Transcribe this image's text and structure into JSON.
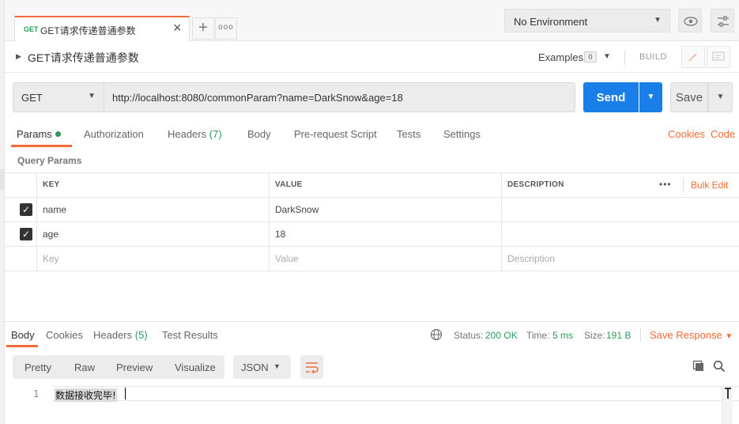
{
  "tab": {
    "method": "GET",
    "name": "GET请求传递普通参数",
    "close": "✕",
    "add": "+",
    "more": "ooo"
  },
  "environment": {
    "selected": "No Environment"
  },
  "request": {
    "title": "GET请求传递普通参数",
    "examples_label": "Examples",
    "examples_count": "0",
    "build_label": "BUILD",
    "method": "GET",
    "url": "http://localhost:8080/commonParam?name=DarkSnow&age=18",
    "send_label": "Send",
    "save_label": "Save"
  },
  "request_tabs": {
    "params": "Params",
    "authorization": "Authorization",
    "headers": "Headers",
    "headers_count": "(7)",
    "body": "Body",
    "prerequest": "Pre-request Script",
    "tests": "Tests",
    "settings": "Settings",
    "cookies": "Cookies",
    "code": "Code"
  },
  "query_params": {
    "label": "Query Params",
    "headers": {
      "key": "KEY",
      "value": "VALUE",
      "description": "DESCRIPTION"
    },
    "more": "•••",
    "bulk_edit": "Bulk Edit",
    "rows": [
      {
        "key": "name",
        "value": "DarkSnow",
        "description": ""
      },
      {
        "key": "age",
        "value": "18",
        "description": ""
      }
    ],
    "placeholders": {
      "key": "Key",
      "value": "Value",
      "description": "Description"
    }
  },
  "response": {
    "tabs": {
      "body": "Body",
      "cookies": "Cookies",
      "headers": "Headers",
      "headers_count": "(5)",
      "test_results": "Test Results"
    },
    "status_label": "Status:",
    "status_value": "200 OK",
    "time_label": "Time:",
    "time_value": "5 ms",
    "size_label": "Size:",
    "size_value": "191 B",
    "save_response": "Save Response",
    "views": {
      "pretty": "Pretty",
      "raw": "Raw",
      "preview": "Preview",
      "visualize": "Visualize"
    },
    "format": "JSON",
    "line_number": "1",
    "body_text": "数据接收完毕!"
  },
  "colors": {
    "accent": "#f26b3a",
    "send": "#1a7ee8",
    "success": "#2b9c5b"
  }
}
